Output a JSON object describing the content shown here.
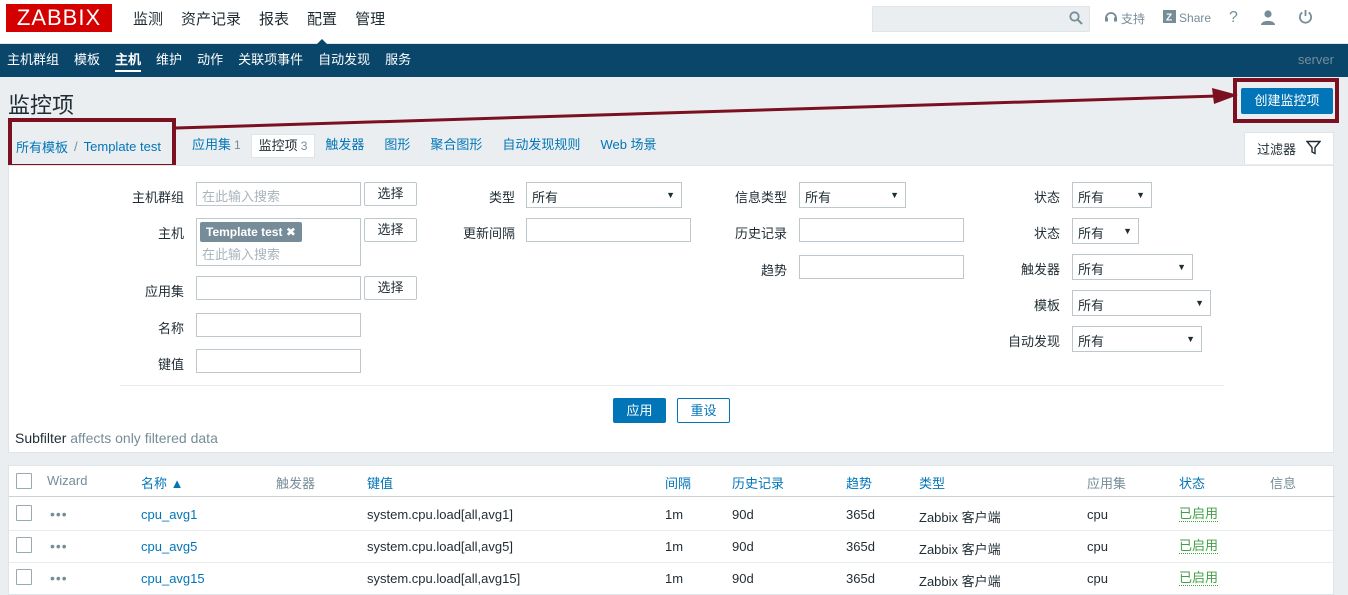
{
  "brand": {
    "logo": "ZABBIX",
    "logo_color": "#d40000"
  },
  "top_nav": [
    "监测",
    "资产记录",
    "报表",
    "配置",
    "管理"
  ],
  "top_nav_active": "配置",
  "top_links": {
    "support": "支持",
    "share": "Share",
    "help": "?"
  },
  "sub_nav": [
    "主机群组",
    "模板",
    "主机",
    "维护",
    "动作",
    "关联项事件",
    "自动发现",
    "服务"
  ],
  "sub_nav_active": "主机",
  "server_label": "server",
  "page": {
    "title": "监控项",
    "create_button": "创建监控项"
  },
  "breadcrumb": {
    "all_templates": "所有模板",
    "separator": "/",
    "template": "Template test"
  },
  "tabs": [
    {
      "label": "应用集",
      "count": "1"
    },
    {
      "label": "监控项",
      "count": "3"
    },
    {
      "label": "触发器",
      "count": ""
    },
    {
      "label": "图形",
      "count": ""
    },
    {
      "label": "聚合图形",
      "count": ""
    },
    {
      "label": "自动发现规则",
      "count": ""
    },
    {
      "label": "Web 场景",
      "count": ""
    }
  ],
  "filter_tab": "过滤器",
  "filter": {
    "host_group_label": "主机群组",
    "host_group_placeholder": "在此输入搜索",
    "select_btn": "选择",
    "host_label": "主机",
    "host_chip": "Template test",
    "host_placeholder": "在此输入搜索",
    "application_label": "应用集",
    "name_label": "名称",
    "key_label": "键值",
    "type_label": "类型",
    "type_value": "所有",
    "interval_label": "更新间隔",
    "info_type_label": "信息类型",
    "info_type_value": "所有",
    "history_label": "历史记录",
    "trends_label": "趋势",
    "state_label": "状态",
    "state_value": "所有",
    "status_label": "状态",
    "status_value": "所有",
    "triggers_label": "触发器",
    "triggers_value": "所有",
    "template_label": "模板",
    "template_value": "所有",
    "discovery_label": "自动发现",
    "discovery_value": "所有",
    "apply": "应用",
    "reset": "重设"
  },
  "subfilter": {
    "label": "Subfilter",
    "note": "affects only filtered data"
  },
  "table": {
    "headers": {
      "wizard": "Wizard",
      "name": "名称 ▲",
      "triggers": "触发器",
      "key": "键值",
      "interval": "间隔",
      "history": "历史记录",
      "trends": "趋势",
      "type": "类型",
      "applications": "应用集",
      "status": "状态",
      "info": "信息"
    },
    "rows": [
      {
        "name": "cpu_avg1",
        "key": "system.cpu.load[all,avg1]",
        "interval": "1m",
        "history": "90d",
        "trends": "365d",
        "type": "Zabbix 客户端",
        "application": "cpu",
        "status": "已启用"
      },
      {
        "name": "cpu_avg5",
        "key": "system.cpu.load[all,avg5]",
        "interval": "1m",
        "history": "90d",
        "trends": "365d",
        "type": "Zabbix 客户端",
        "application": "cpu",
        "status": "已启用"
      },
      {
        "name": "cpu_avg15",
        "key": "system.cpu.load[all,avg15]",
        "interval": "1m",
        "history": "90d",
        "trends": "365d",
        "type": "Zabbix 客户端",
        "application": "cpu",
        "status": "已启用"
      }
    ]
  },
  "colors": {
    "nav_bg": "#0a466a",
    "primary": "#0275b8",
    "enabled": "#429e47",
    "annotation": "#7a1020"
  }
}
